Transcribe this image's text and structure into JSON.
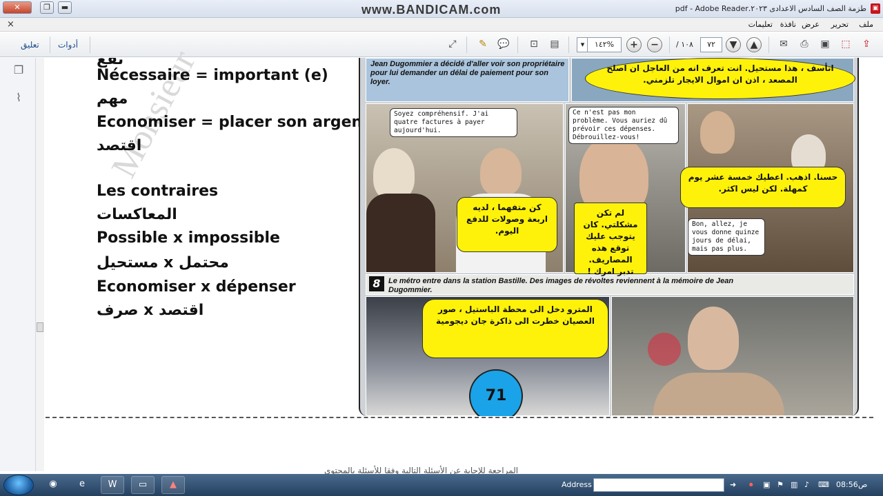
{
  "window": {
    "title": "طزمة الصف السادس الاعدادى ٢٠٢٣.pdf - Adobe Reader",
    "watermark": "www.BANDICAM.com",
    "app_icon": "pdf-icon",
    "minimize_label": "▬",
    "maximize_label": "❐",
    "close_label": "✕"
  },
  "menubar": {
    "items": [
      "ملف",
      "تحرير",
      "عرض",
      "نافذة",
      "تعليمات"
    ],
    "close_left": "×",
    "close_right": "×"
  },
  "toolbar": {
    "tools_label": "أدوات",
    "comment_label": "تعليق",
    "zoom_value": "١٤٢%",
    "page_current": "٧٢",
    "page_total": "/ ١٠٨",
    "zoom_in": "+",
    "zoom_out": "−"
  },
  "doc": {
    "lines": [
      {
        "text": "Nécessaire  = important (e)"
      },
      {
        "text": "مهم"
      },
      {
        "text": "Economiser  = placer son argent"
      },
      {
        "text": "اقتصد"
      },
      {
        "text": "Les contraires"
      },
      {
        "text": "المعاكسات"
      },
      {
        "text": "Possible x impossible"
      },
      {
        "text": "مستحيل  x  محتمل"
      },
      {
        "text": "Economiser  x  dépenser"
      },
      {
        "text": "صرف  x  اقتصد"
      }
    ],
    "top_clipped": "نفع",
    "ghost_text": "Monsieur",
    "bottom_text": "المراجعة للإجابة عن الأسئلة التالية وفقا للأسئلة بالمحتوى"
  },
  "comic": {
    "caption_top": "Jean Dugommier a décidé d'aller voir son propriétaire pour lui demander un délai de paiement pour son loyer.",
    "bubble_fr_1": "Soyez compréhensif. J'ai quatre factures à payer aujourd'hui.",
    "bubble_fr_2": "Ce n'est pas mon problème. Vous auriez dû prévoir ces dépenses. Débrouillez-vous!",
    "bubble_fr_3": "Bon, allez, je vous donne quinze jours de délai, mais pas plus.",
    "caption_8_num": "8",
    "caption_8": "Le métro entre dans la station Bastille. Des images de révoltes reviennent à la mémoire de Jean Dugommier.",
    "ar_1": "اتأسف ، هذا مستحيل. انت تعرف انه من العاجل ان اصلح المصعد ، اذن ان اموال الايجار تلزمني.",
    "ar_2": "كن متفهما ، لديه اربعة وصولات للدفع اليوم.",
    "ar_3": "لم تكن مشكلتي. كان يتوجب عليك توقع هذه المصاريف. تدبر امرك !",
    "ar_4": "حسنا. اذهب. اعطيك خمسة عشر يوم كمهلة. لكن ليس اكثر.",
    "ar_5": "المترو دخل الى محطة الباستيل ، صور العصيان خطرت الى ذاكرة جان ديجومية",
    "page_badge": "71"
  },
  "taskbar": {
    "address_label": "Address",
    "clock": "08:56",
    "ampm": "ص",
    "apps": [
      "ie-icon",
      "chrome-icon",
      "word-icon",
      "notepad-icon",
      "acrobat-icon"
    ]
  },
  "colors": {
    "bubble_yellow": "#fff20a",
    "badge_blue": "#1aa3e8",
    "toolbar_link": "#1f4e8c"
  }
}
